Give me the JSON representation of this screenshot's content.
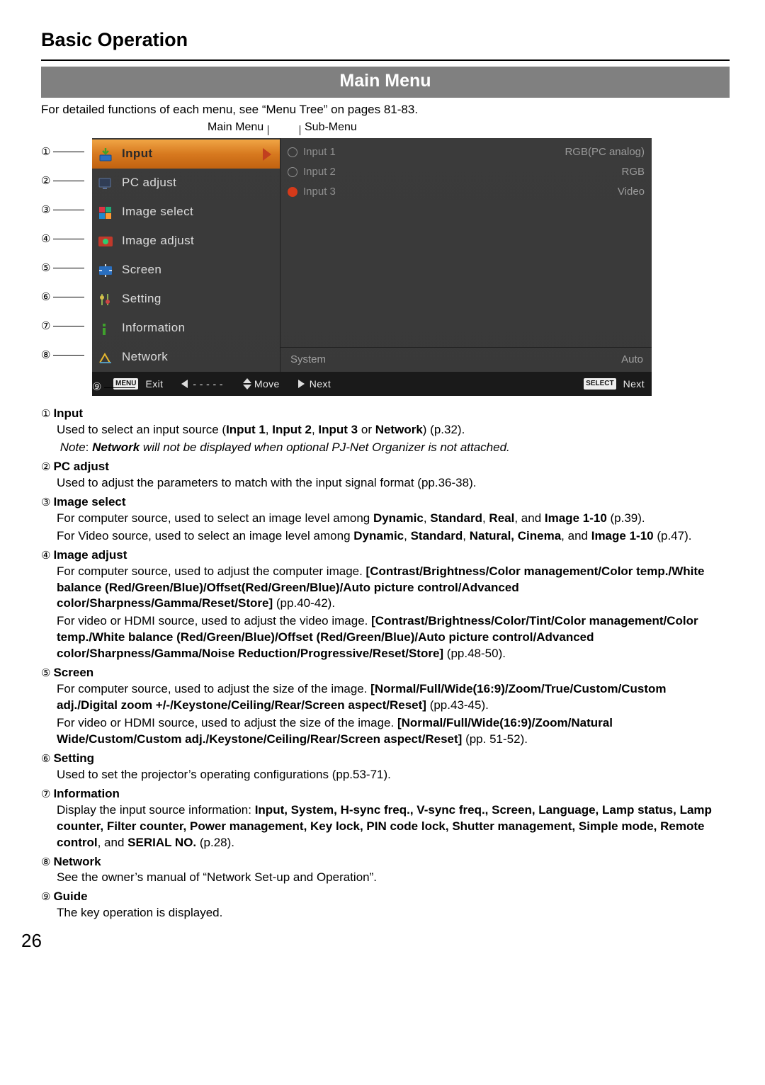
{
  "section_title": "Basic Operation",
  "subsection_title": "Main Menu",
  "intro": "For detailed functions of each menu, see “Menu Tree” on pages 81-83.",
  "labels": {
    "main": "Main Menu",
    "sub": "Sub-Menu"
  },
  "menu": {
    "items": [
      {
        "label": "Input",
        "selected": true
      },
      {
        "label": "PC adjust"
      },
      {
        "label": "Image select"
      },
      {
        "label": "Image adjust"
      },
      {
        "label": "Screen"
      },
      {
        "label": "Setting"
      },
      {
        "label": "Information"
      },
      {
        "label": "Network"
      }
    ],
    "sub_items": [
      {
        "label": "Input 1",
        "right": "RGB(PC analog)",
        "filled": false
      },
      {
        "label": "Input 2",
        "right": "RGB",
        "filled": false
      },
      {
        "label": "Input 3",
        "right": "Video",
        "filled": true
      }
    ],
    "system_label": "System",
    "system_value": "Auto",
    "guide": {
      "menu_tag": "MENU",
      "exit": "Exit",
      "dashes": "- - - - -",
      "move": "Move",
      "next1": "Next",
      "select_tag": "SELECT",
      "next2": "Next"
    }
  },
  "numbers": [
    "①",
    "②",
    "③",
    "④",
    "⑤",
    "⑥",
    "⑦",
    "⑧",
    "⑨"
  ],
  "desc": {
    "d1_title": "Input",
    "d1_line1a": "Used to select an input source (",
    "d1_input1": "Input 1",
    "d1_input2": "Input 2",
    "d1_input3": "Input 3",
    "d1_or": " or ",
    "d1_net": "Network",
    "d1_line1b": ") (p.32).",
    "d1_note_pre": "Note",
    "d1_note_colon": ": ",
    "d1_note_b": "Network",
    "d1_note_rest": " will not be displayed when optional PJ-Net Organizer is not attached.",
    "d2_title": "PC adjust",
    "d2_body": "Used to adjust the parameters to match with the input signal format (pp.36-38).",
    "d3_title": "Image select",
    "d3_a": "For computer source, used to select an image level among ",
    "d3_b1": "Dynamic",
    "d3_b2": "Standard",
    "d3_b3": "Real",
    "d3_b4": "Image 1-10",
    "d3_c": " (p.39).",
    "d3_d": "For Video source, used to select an image level among ",
    "d3_e1": "Dynamic",
    "d3_e2": "Standard",
    "d3_e3": "Natural, Cinema",
    "d3_e4": "Image 1-10",
    "d3_f": " (p.47).",
    "d4_title": "Image adjust",
    "d4_a": "For computer source, used to adjust the computer image. ",
    "d4_b": "[Contrast/Brightness/Color management/Color temp./White balance (Red/Green/Blue)/Offset(Red/Green/Blue)/Auto picture control/Advanced color/Sharpness/Gamma/Reset/Store]",
    "d4_c": " (pp.40-42).",
    "d4_d": "For video or HDMI source, used to adjust the video image. ",
    "d4_e": "[Contrast/Brightness/Color/Tint/Color management/Color temp./White balance (Red/Green/Blue)/Offset (Red/Green/Blue)/Auto picture control/Advanced color/Sharpness/Gamma/Noise Reduction/Progressive/Reset/Store]",
    "d4_f": " (pp.48-50).",
    "d5_title": "Screen",
    "d5_a": "For computer source, used to adjust the size of the image.  ",
    "d5_b": "[Normal/Full/Wide(16:9)/Zoom/True/Custom/Custom adj./Digital zoom +/-/Keystone/Ceiling/Rear/Screen aspect/Reset]",
    "d5_c": " (pp.43-45).",
    "d5_d": "For video or HDMI source, used to adjust the size of the image.  ",
    "d5_e": "[Normal/Full/Wide(16:9)/Zoom/Natural Wide/Custom/Custom adj./Keystone/Ceiling/Rear/Screen aspect/Reset]",
    "d5_f": " (pp. 51-52).",
    "d6_title": "Setting",
    "d6_body": "Used to set the projector’s operating configurations (pp.53-71).",
    "d7_title": "Information",
    "d7_a": "Display the input source information: ",
    "d7_b": "Input, System, H-sync freq., V-sync freq., Screen, Language, Lamp status, Lamp counter, Filter counter, Power management, Key lock, PIN code lock, Shutter management, Simple mode, Remote control",
    "d7_c": ", and ",
    "d7_d": "SERIAL NO.",
    "d7_e": " (p.28).",
    "d8_title": "Network",
    "d8_body": "See the owner’s manual of “Network Set-up and Operation”.",
    "d9_title": "Guide",
    "d9_body": "The key operation is displayed."
  },
  "page_number": "26"
}
